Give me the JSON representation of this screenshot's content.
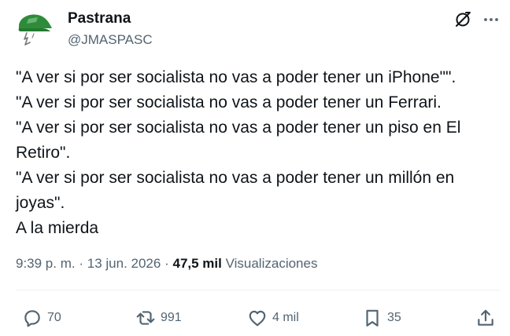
{
  "author": {
    "name": "Pastrana",
    "handle": "@JMASPASC"
  },
  "tweet": {
    "lines": [
      "\"A ver si por ser socialista no vas a poder tener un iPhone\"\".",
      "\"A ver si por ser socialista no vas a poder tener un Ferrari.",
      "\"A ver si por ser socialista no vas a poder tener un piso en El",
      "Retiro\".",
      "\"A ver si por ser socialista no vas a poder tener un millón en",
      "joyas\".",
      "A la mierda"
    ]
  },
  "meta": {
    "time": "9:39 p. m.",
    "separator": "·",
    "date": "13 jun. 2026",
    "views_count": "47,5 mil",
    "views_label": "Visualizaciones"
  },
  "actions": {
    "replies": "70",
    "retweets": "991",
    "likes": "4 mil",
    "bookmarks": "35"
  },
  "icons": {
    "avatar": "green-cap-avatar",
    "grok": "grok-icon",
    "more": "more-icon",
    "reply": "reply-icon",
    "retweet": "retweet-icon",
    "like": "heart-icon",
    "bookmark": "bookmark-icon",
    "share": "share-icon"
  },
  "colors": {
    "text": "#0f1419",
    "secondary": "#536471",
    "divider": "#eff3f4",
    "avatar_green": "#2e8b3a"
  }
}
